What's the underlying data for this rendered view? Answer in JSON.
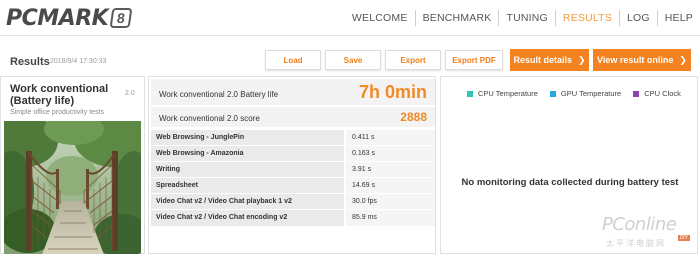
{
  "app": {
    "logo_text": "PCMARK",
    "logo_badge": "8"
  },
  "nav": {
    "items": [
      "WELCOME",
      "BENCHMARK",
      "TUNING",
      "RESULTS",
      "LOG",
      "HELP"
    ],
    "active": "RESULTS",
    "accent_color": "#f39a3d"
  },
  "results": {
    "title": "Results",
    "date": "2018/9/4 17:30:33",
    "buttons": {
      "load": "Load",
      "save": "Save",
      "export": "Export",
      "export_pdf": "Export PDF",
      "result_details": "Result details",
      "view_online": "View result online"
    },
    "button_color": "#f58220"
  },
  "test_card": {
    "title": "Work conventional (Battery life)",
    "version": "2.0",
    "subtitle": "Simple office productivity tests"
  },
  "scores": {
    "battery_life": {
      "label": "Work conventional 2.0 Battery life",
      "value": "7h 0min"
    },
    "score": {
      "label": "Work conventional 2.0 score",
      "value": "2888"
    },
    "value_color": "#f08a26",
    "subtests": [
      {
        "name": "Web Browsing - JunglePin",
        "value": "0.411 s"
      },
      {
        "name": "Web Browsing - Amazonia",
        "value": "0.163 s"
      },
      {
        "name": "Writing",
        "value": "3.91 s"
      },
      {
        "name": "Spreadsheet",
        "value": "14.69 s"
      },
      {
        "name": "Video Chat v2 / Video Chat playback 1 v2",
        "value": "30.0 fps"
      },
      {
        "name": "Video Chat v2 / Video Chat encoding v2",
        "value": "85.9 ms"
      }
    ]
  },
  "monitoring": {
    "legend": [
      {
        "label": "CPU Temperature",
        "color": "#2ec4b6"
      },
      {
        "label": "GPU Temperature",
        "color": "#2aa7e0"
      },
      {
        "label": "CPU Clock",
        "color": "#8e44ad"
      }
    ],
    "message": "No monitoring data collected during battery test"
  },
  "watermark": {
    "main": "PConline",
    "sub": "太平洋电脑网",
    "tag": "DIY"
  }
}
